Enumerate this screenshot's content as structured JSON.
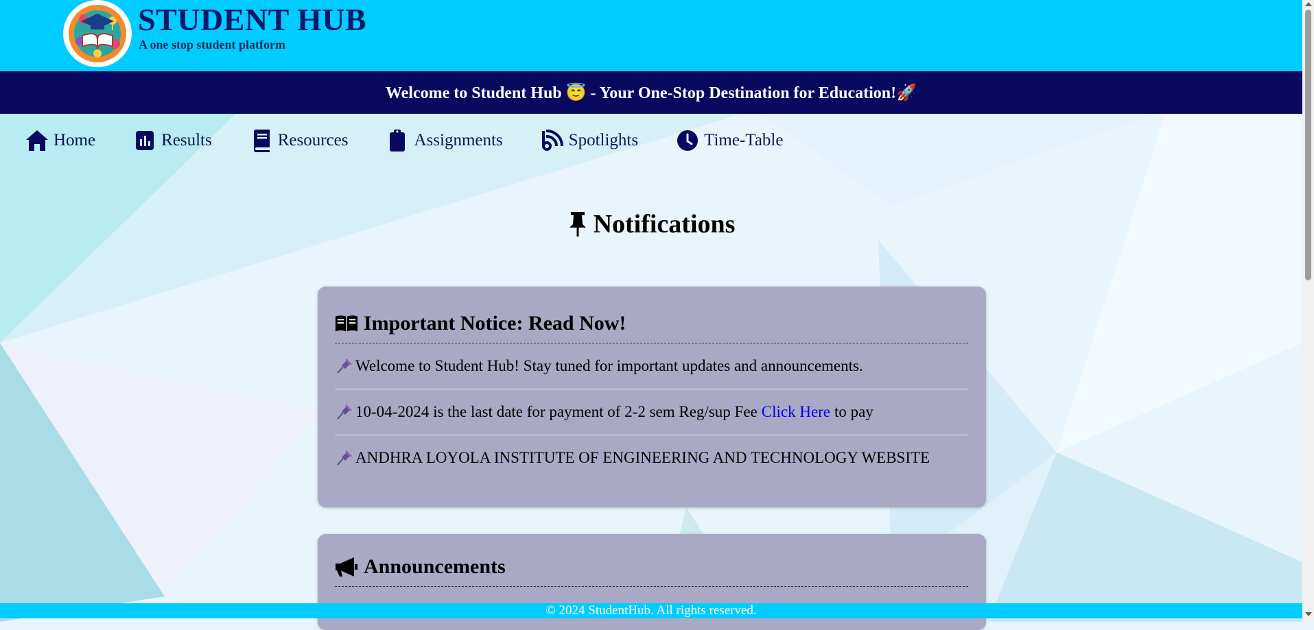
{
  "header": {
    "title": "STUDENT HUB",
    "tagline": "A one stop student platform"
  },
  "banner": {
    "text": "Welcome to Student Hub 😇 - Your One-Stop Destination for Education!🚀"
  },
  "nav": [
    {
      "label": "Home",
      "icon": "home-icon"
    },
    {
      "label": "Results",
      "icon": "chart-icon"
    },
    {
      "label": "Resources",
      "icon": "book-icon"
    },
    {
      "label": "Assignments",
      "icon": "clipboard-icon"
    },
    {
      "label": "Spotlights",
      "icon": "rss-icon"
    },
    {
      "label": "Time-Table",
      "icon": "clock-icon"
    }
  ],
  "notifications": {
    "title": "Notifications",
    "important": {
      "title": "Important Notice: Read Now!",
      "items": [
        {
          "text": "Welcome to Student Hub! Stay tuned for important updates and announcements."
        },
        {
          "text_before": "10-04-2024 is the last date for payment of 2-2 sem Reg/sup Fee",
          "link": "Click Here",
          "text_after": "to pay"
        },
        {
          "text": "ANDHRA LOYOLA INSTITUTE OF ENGINEERING AND TECHNOLOGY WEBSITE"
        }
      ]
    },
    "announcements": {
      "title": "Announcements"
    }
  },
  "footer": {
    "text": "© 2024 StudentHub. All rights reserved."
  },
  "colors": {
    "header": "#00ccff",
    "banner": "#08085e",
    "card": "#a9a9c5",
    "nav_text": "#0b1650",
    "link": "#0000ee"
  }
}
